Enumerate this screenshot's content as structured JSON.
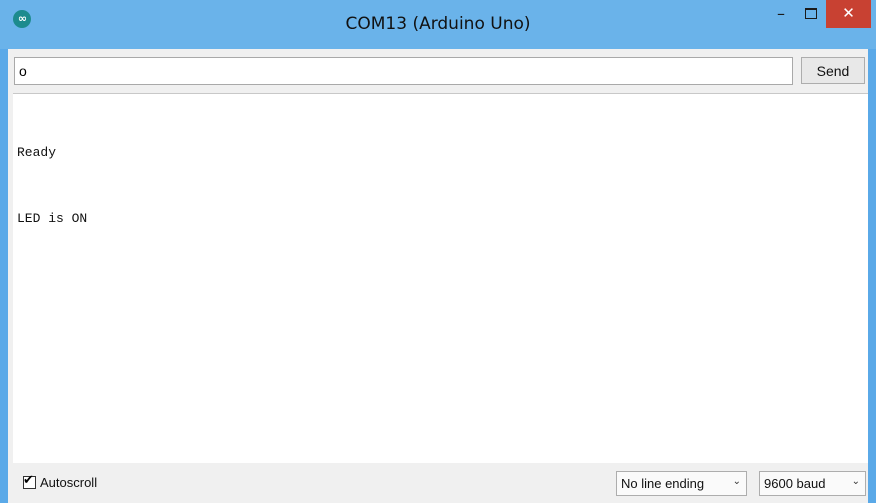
{
  "window": {
    "title": "COM13 (Arduino Uno)",
    "app_icon_glyph": "∞",
    "minimize_glyph": "–",
    "close_glyph": "✕"
  },
  "input": {
    "value": "o",
    "send_label": "Send"
  },
  "output": {
    "lines": [
      "Ready",
      "LED is ON"
    ]
  },
  "bottom": {
    "autoscroll_label": "Autoscroll",
    "autoscroll_checked": true,
    "line_ending": "No line ending",
    "baud": "9600 baud",
    "caret_glyph": "⌄"
  },
  "colors": {
    "titlebar": "#6ab3ea",
    "close_button": "#c84132",
    "app_icon": "#1d8b8e"
  }
}
